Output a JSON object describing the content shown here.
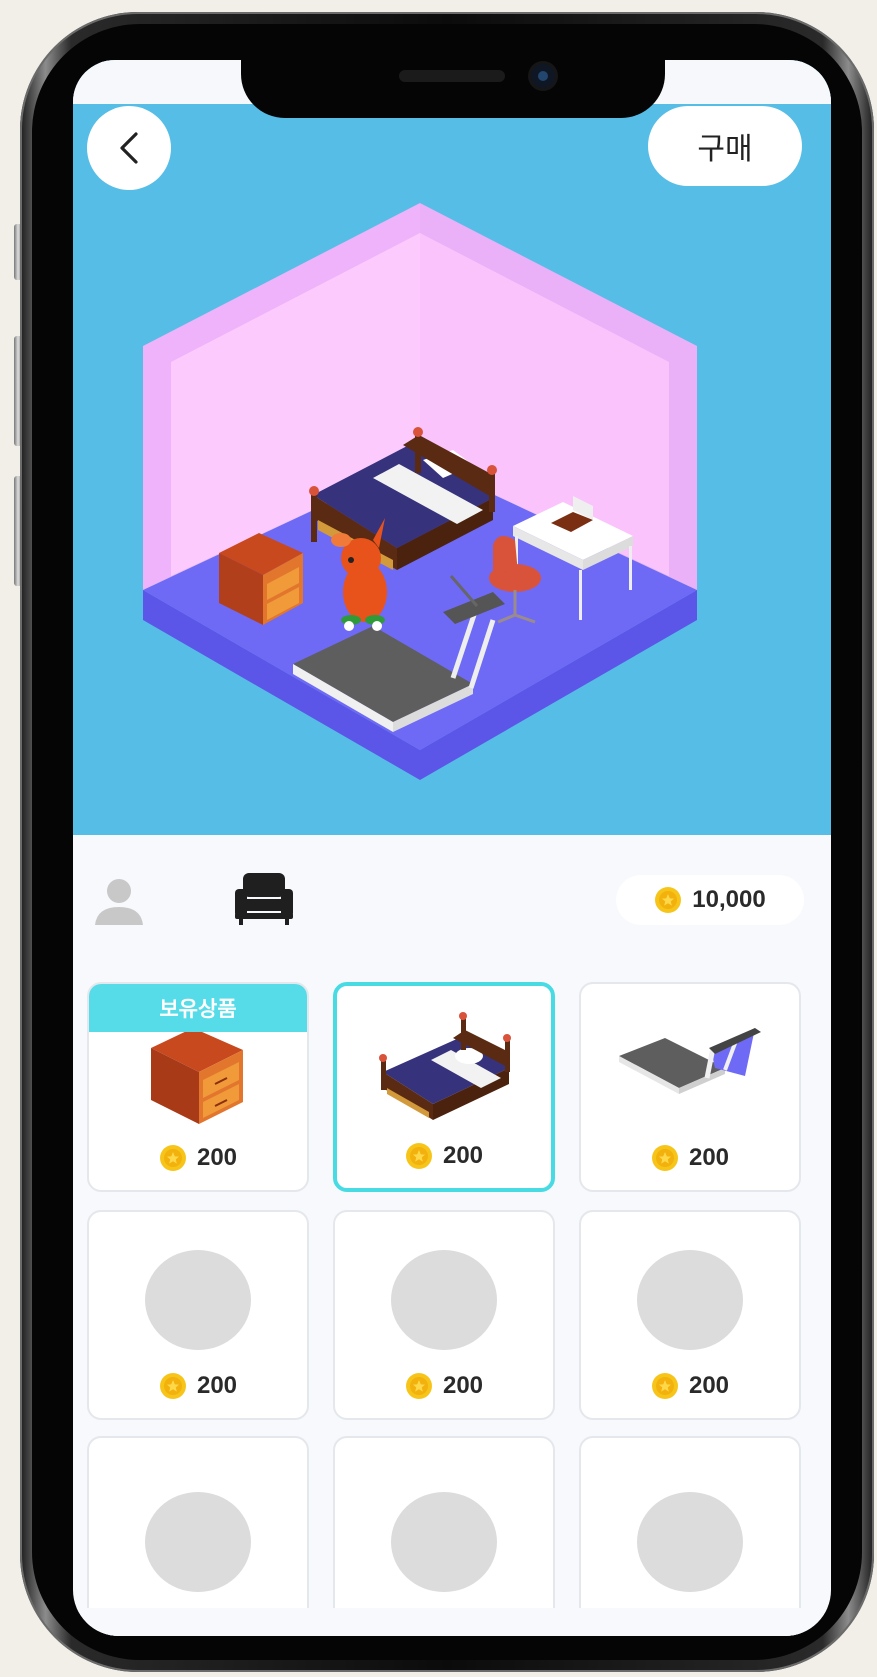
{
  "header": {
    "back_label": "",
    "buy_label": "구매"
  },
  "toolbar": {
    "tabs": [
      {
        "icon": "avatar-icon"
      },
      {
        "icon": "sofa-icon"
      }
    ],
    "coins": "10,000"
  },
  "items": [
    {
      "tag": "보유상품",
      "price": "200",
      "image": "drawer-icon",
      "owned": true
    },
    {
      "tag": "",
      "price": "200",
      "image": "bed-icon",
      "selected": true
    },
    {
      "tag": "",
      "price": "200",
      "image": "treadmill-icon"
    },
    {
      "tag": "",
      "price": "200",
      "image": "placeholder"
    },
    {
      "tag": "",
      "price": "200",
      "image": "placeholder"
    },
    {
      "tag": "",
      "price": "200",
      "image": "placeholder"
    },
    {
      "tag": "",
      "price": "",
      "image": "placeholder"
    },
    {
      "tag": "",
      "price": "",
      "image": "placeholder"
    },
    {
      "tag": "",
      "price": "",
      "image": "placeholder"
    }
  ],
  "colors": {
    "scene_bg": "#56bde6",
    "accent": "#49dbe4",
    "coin": "#f2c21a",
    "wall": "#f9c6fb",
    "floor": "#6f6af5"
  }
}
